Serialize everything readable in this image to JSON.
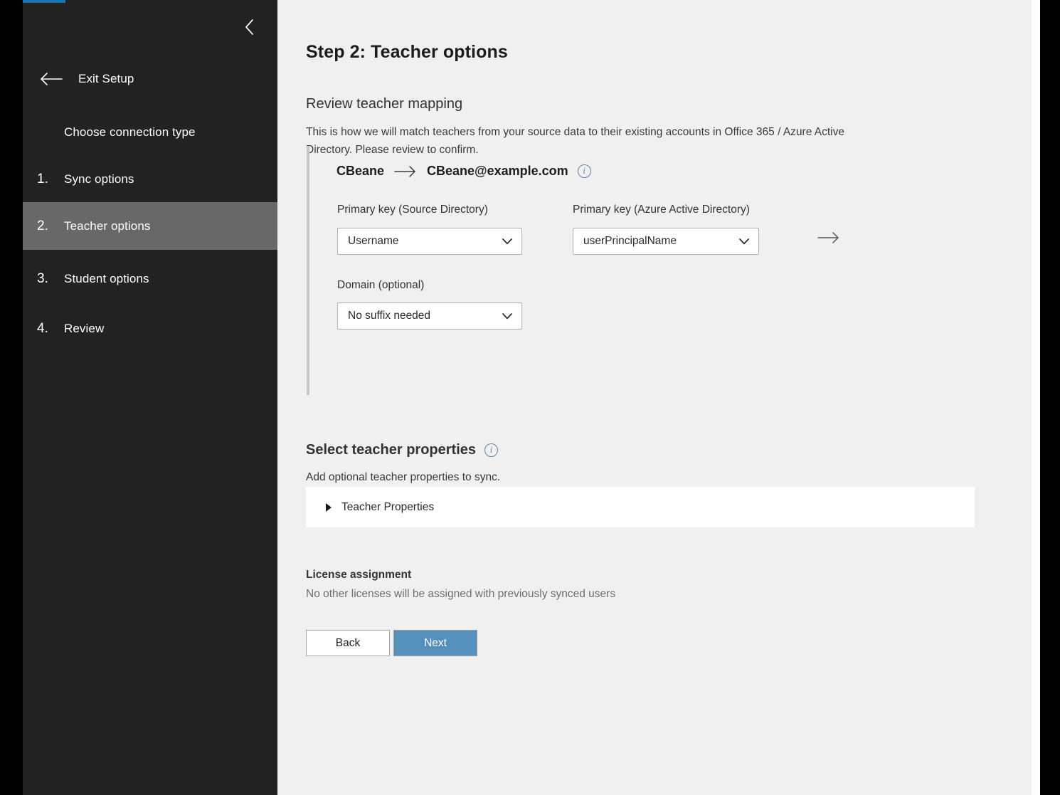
{
  "sidebar": {
    "collapse_icon": "chevron-left-icon",
    "exit": {
      "icon": "arrow-left-icon",
      "label": "Exit Setup"
    },
    "items": [
      {
        "num": "",
        "label": "Choose connection type",
        "selected": false
      },
      {
        "num": "1.",
        "label": "Sync options",
        "selected": false
      },
      {
        "num": "2.",
        "label": "Teacher options",
        "selected": true
      },
      {
        "num": "3.",
        "label": "Student options",
        "selected": false
      },
      {
        "num": "4.",
        "label": "Review",
        "selected": false
      }
    ]
  },
  "main": {
    "step_title": "Step 2: Teacher options",
    "review_mapping": {
      "heading": "Review teacher mapping",
      "description": "This is how we will match teachers from your source data to their existing accounts in Office 365 / Azure Active Directory. Please review to confirm.",
      "identity": {
        "source": "CBeane",
        "arrow": "arrow-right-icon",
        "target": "CBeane@example.com",
        "info_icon": "info-icon"
      },
      "source_key": {
        "label": "Primary key (Source Directory)",
        "value": "Username"
      },
      "target_key": {
        "label": "Primary key (Azure Active Directory)",
        "value": "userPrincipalName"
      },
      "domain": {
        "label": "Domain (optional)",
        "value": "No suffix needed"
      }
    },
    "teacher_properties": {
      "heading": "Select teacher properties",
      "info_icon": "info-icon",
      "description": "Add optional teacher properties to sync.",
      "panel_label": "Teacher Properties",
      "panel_expanded": false
    },
    "license": {
      "heading": "License assignment",
      "description": "No other licenses will be assigned with previously synced users"
    },
    "footer": {
      "back_label": "Back",
      "next_label": "Next"
    }
  },
  "colors": {
    "accent_line": "#1277b8",
    "sidebar_bg": "#222222",
    "sidebar_selected": "#686868",
    "content_bg": "#f0f0f0",
    "primary_button": "#5590bd",
    "info_icon": "#5d83a8"
  }
}
